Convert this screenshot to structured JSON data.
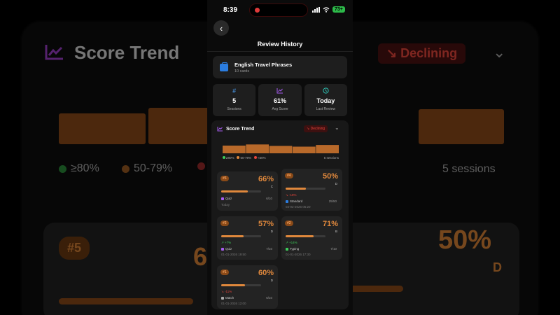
{
  "status_bar": {
    "time": "8:39",
    "battery": "73+"
  },
  "nav": {
    "title": "Review History",
    "back_icon": "chevron-left-icon"
  },
  "deck": {
    "name": "English Travel Phrases",
    "count": "10 cards",
    "icon": "briefcase-icon",
    "icon_color": "#2b7de0"
  },
  "stats": [
    {
      "icon": "hash-icon",
      "value": "5",
      "label": "Sessions",
      "color": "#4a9df0"
    },
    {
      "icon": "trend-up-icon",
      "value": "61%",
      "label": "Avg Score",
      "color": "#a65cf0"
    },
    {
      "icon": "clock-icon",
      "value": "Today",
      "label": "Last Review",
      "color": "#2ec4b6"
    }
  ],
  "trend": {
    "title": "Score Trend",
    "badge": "↘ Declining",
    "legend": [
      {
        "label": "≥80%",
        "color": "#3dcc5a"
      },
      {
        "label": "50-79%",
        "color": "#e0883c"
      },
      {
        "label": "<50%",
        "color": "#e6453b"
      }
    ],
    "sessions_label": "5 sessions",
    "bar_color": "#b8692a"
  },
  "chart_data": {
    "type": "bar",
    "categories": [
      "#1",
      "#2",
      "#3",
      "#4",
      "#5"
    ],
    "values": [
      60,
      71,
      57,
      50,
      66
    ],
    "title": "Score Trend",
    "ylim": [
      0,
      100
    ]
  },
  "cards": [
    {
      "num": "#5",
      "pct": "66%",
      "grade": "C",
      "progress": 0.66,
      "delta": "",
      "delta_dir": "",
      "mode": "Quiz",
      "mode_color": "#a65cf0",
      "score": "6/10",
      "date": "Today"
    },
    {
      "num": "#4",
      "pct": "50%",
      "grade": "D",
      "progress": 0.5,
      "delta": "↘ -18%",
      "delta_dir": "down",
      "mode": "Standard",
      "mode_color": "#2b7de0",
      "score": "25/50",
      "date": "03-02-2026 05:20"
    },
    {
      "num": "#3",
      "pct": "57%",
      "grade": "D",
      "progress": 0.57,
      "delta": "↗ +7%",
      "delta_dir": "up",
      "mode": "Quiz",
      "mode_color": "#a65cf0",
      "score": "7/10",
      "date": "01-01-2026 19:50"
    },
    {
      "num": "#2",
      "pct": "71%",
      "grade": "B",
      "progress": 0.71,
      "delta": "↗ +14%",
      "delta_dir": "up",
      "mode": "Typing",
      "mode_color": "#3dcc5a",
      "score": "7/10",
      "date": "01-01-2026 17:30"
    },
    {
      "num": "#1",
      "pct": "60%",
      "grade": "D",
      "progress": 0.6,
      "delta": "↘ -11%",
      "delta_dir": "down",
      "mode": "Match",
      "mode_color": "#aaaaaa",
      "score": "6/10",
      "date": "01-01-2026 12:00"
    }
  ],
  "background": {
    "title": "Score Trend",
    "badge": "↘ Declining",
    "legend": [
      "≥80%",
      "50-79%"
    ],
    "sessions_label": "5 sessions",
    "card_num": "#5",
    "card_pct_left": "6",
    "card_pct_right": "50%",
    "card_grade_right": "D"
  }
}
